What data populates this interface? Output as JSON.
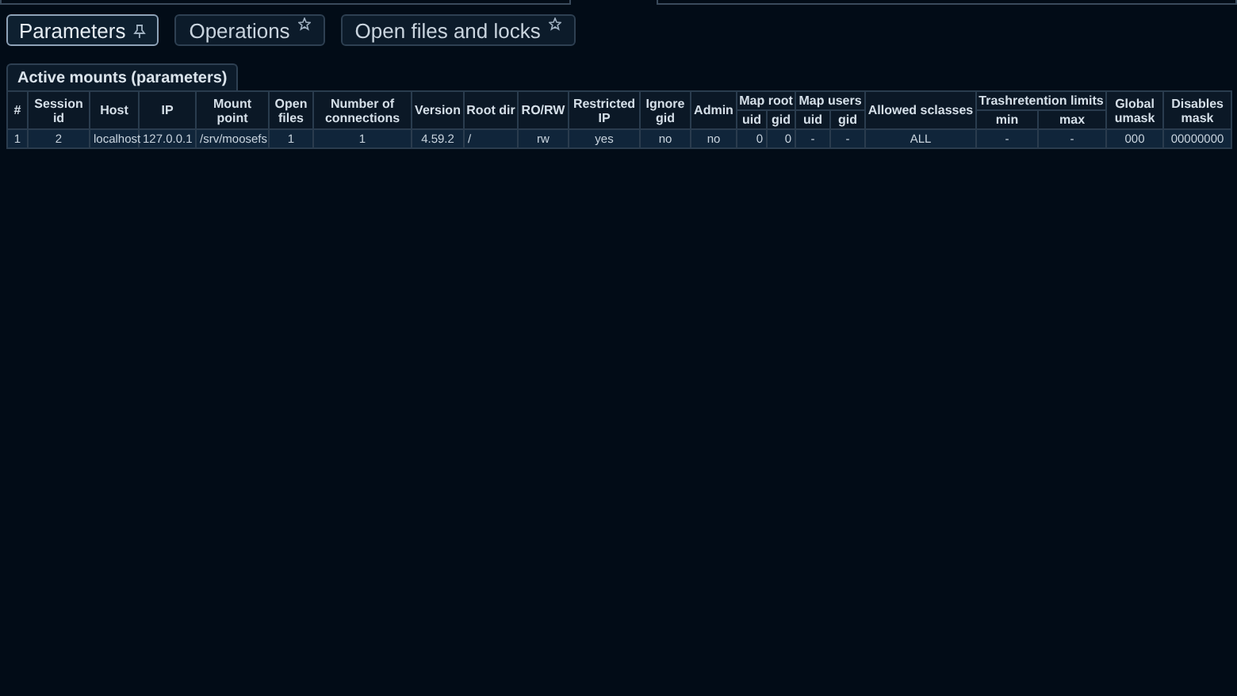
{
  "tabs": [
    {
      "label": "Parameters",
      "selected": true
    },
    {
      "label": "Operations",
      "selected": false
    },
    {
      "label": "Open files and locks",
      "selected": false
    }
  ],
  "panel": {
    "title": "Active mounts (parameters)"
  },
  "table": {
    "columns": [
      {
        "label": "#"
      },
      {
        "label": "Session id"
      },
      {
        "label": "Host"
      },
      {
        "label": "IP"
      },
      {
        "label": "Mount point"
      },
      {
        "label": "Open files"
      },
      {
        "label": "Number of connections"
      },
      {
        "label": "Version"
      },
      {
        "label": "Root dir"
      },
      {
        "label": "RO/RW"
      },
      {
        "label": "Restricted IP"
      },
      {
        "label": "Ignore gid"
      },
      {
        "label": "Admin"
      },
      {
        "label": "Map root",
        "colspan": 2,
        "children": [
          "uid",
          "gid"
        ]
      },
      {
        "label": "Map users",
        "colspan": 2,
        "children": [
          "uid",
          "gid"
        ]
      },
      {
        "label": "Allowed sclasses"
      },
      {
        "label": "Trashretention limits",
        "colspan": 2,
        "children": [
          "min",
          "max"
        ]
      },
      {
        "label": "Global umask"
      },
      {
        "label": "Disables mask"
      }
    ],
    "rows": [
      [
        "1",
        "2",
        "localhost",
        "127.0.0.1",
        "/srv/moosefs",
        "1",
        "1",
        "4.59.2",
        "/",
        "rw",
        "yes",
        "no",
        "no",
        "0",
        "0",
        "-",
        "-",
        "ALL",
        "-",
        "-",
        "000",
        "00000000"
      ]
    ]
  }
}
